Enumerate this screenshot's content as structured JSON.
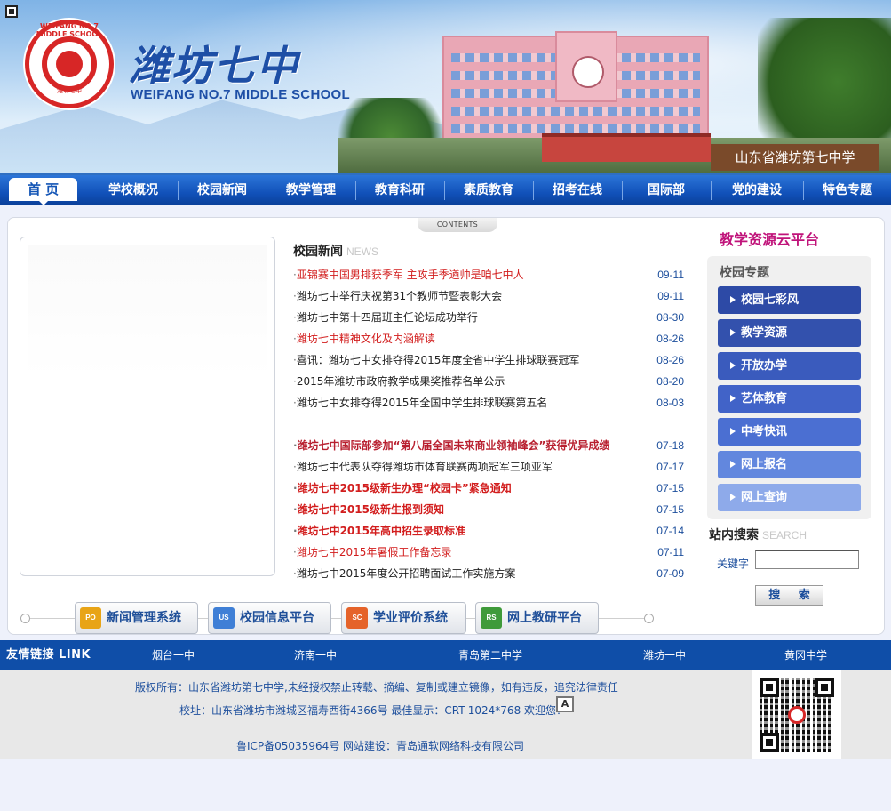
{
  "header": {
    "school_cn": "潍坊七中",
    "school_en": "WEIFANG NO.7 MIDDLE SCHOOL",
    "seal_text": "WEIFANG NO.7 MIDDLE SCHOOL",
    "seal_sub": "潍坊七中",
    "wall_sign": "山东省潍坊第七中学"
  },
  "nav": {
    "home": "首 页",
    "items": [
      "学校概况",
      "校园新闻",
      "教学管理",
      "教育科研",
      "素质教育",
      "招考在线",
      "国际部",
      "党的建设",
      "特色专题"
    ]
  },
  "contents_tab": "CONTENTS",
  "news": {
    "title": "校园新闻",
    "title_en": "NEWS",
    "items": [
      {
        "title": "亚锦赛中国男排获季军  主攻手季遒帅是咱七中人",
        "date": "09-11"
      },
      {
        "title": "潍坊七中举行庆祝第31个教师节暨表彰大会",
        "date": "09-11"
      },
      {
        "title": "潍坊七中第十四届班主任论坛成功举行",
        "date": "08-30"
      },
      {
        "title": "潍坊七中精神文化及内涵解读",
        "date": "08-26"
      },
      {
        "title": "喜讯：潍坊七中女排夺得2015年度全省中学生排球联赛冠军",
        "date": "08-26"
      },
      {
        "title": "2015年潍坊市政府教学成果奖推荐名单公示",
        "date": "08-20"
      },
      {
        "title": "潍坊七中女排夺得2015年全国中学生排球联赛第五名",
        "date": "08-03"
      },
      {
        "title": "潍坊七中国际部参加“第八届全国未来商业领袖峰会”获得优异成绩",
        "date": "07-18"
      },
      {
        "title": "潍坊七中代表队夺得潍坊市体育联赛两项冠军三项亚军",
        "date": "07-17"
      },
      {
        "title": "潍坊七中2015级新生办理“校园卡”紧急通知",
        "date": "07-15"
      },
      {
        "title": "潍坊七中2015级新生报到须知",
        "date": "07-15"
      },
      {
        "title": "潍坊七中2015年高中招生录取标准",
        "date": "07-14"
      },
      {
        "title": "潍坊七中2015年暑假工作备忘录",
        "date": "07-11"
      },
      {
        "title": "潍坊七中2015年度公开招聘面试工作实施方案",
        "date": "07-09"
      }
    ]
  },
  "sidebar": {
    "cloud_link": "教学资源云平台",
    "topics_title": "校园专题",
    "topics": [
      "校园七彩风",
      "教学资源",
      "开放办学",
      "艺体教育",
      "中考快讯",
      "网上报名",
      "网上查询"
    ]
  },
  "search": {
    "title": "站内搜索",
    "title_en": "SEARCH",
    "keyword_label": "关键字",
    "keyword_value": "",
    "button": "搜 索"
  },
  "systems": [
    {
      "code": "PO",
      "label": "新闻管理系统",
      "color": "#e8a417"
    },
    {
      "code": "US",
      "label": "校园信息平台",
      "color": "#3f7fd6"
    },
    {
      "code": "SC",
      "label": "学业评价系统",
      "color": "#e5632a"
    },
    {
      "code": "RS",
      "label": "网上教研平台",
      "color": "#3f9a3a"
    }
  ],
  "links": {
    "title": "友情链接 LINK",
    "items": [
      "烟台一中",
      "济南一中",
      "青岛第二中学",
      "潍坊一中",
      "黄冈中学"
    ]
  },
  "footer": {
    "copyright": "版权所有：山东省潍坊第七中学,未经授权禁止转载、摘编、复制或建立镜像，如有违反，追究法律责任",
    "address": "校址：山东省潍坊市潍城区福寿西街4366号  最佳显示：CRT-1024*768 欢迎您！",
    "wap_icon": "A",
    "icp": "鲁ICP备05035964号  网站建设：青岛通软网络科技有限公司"
  }
}
